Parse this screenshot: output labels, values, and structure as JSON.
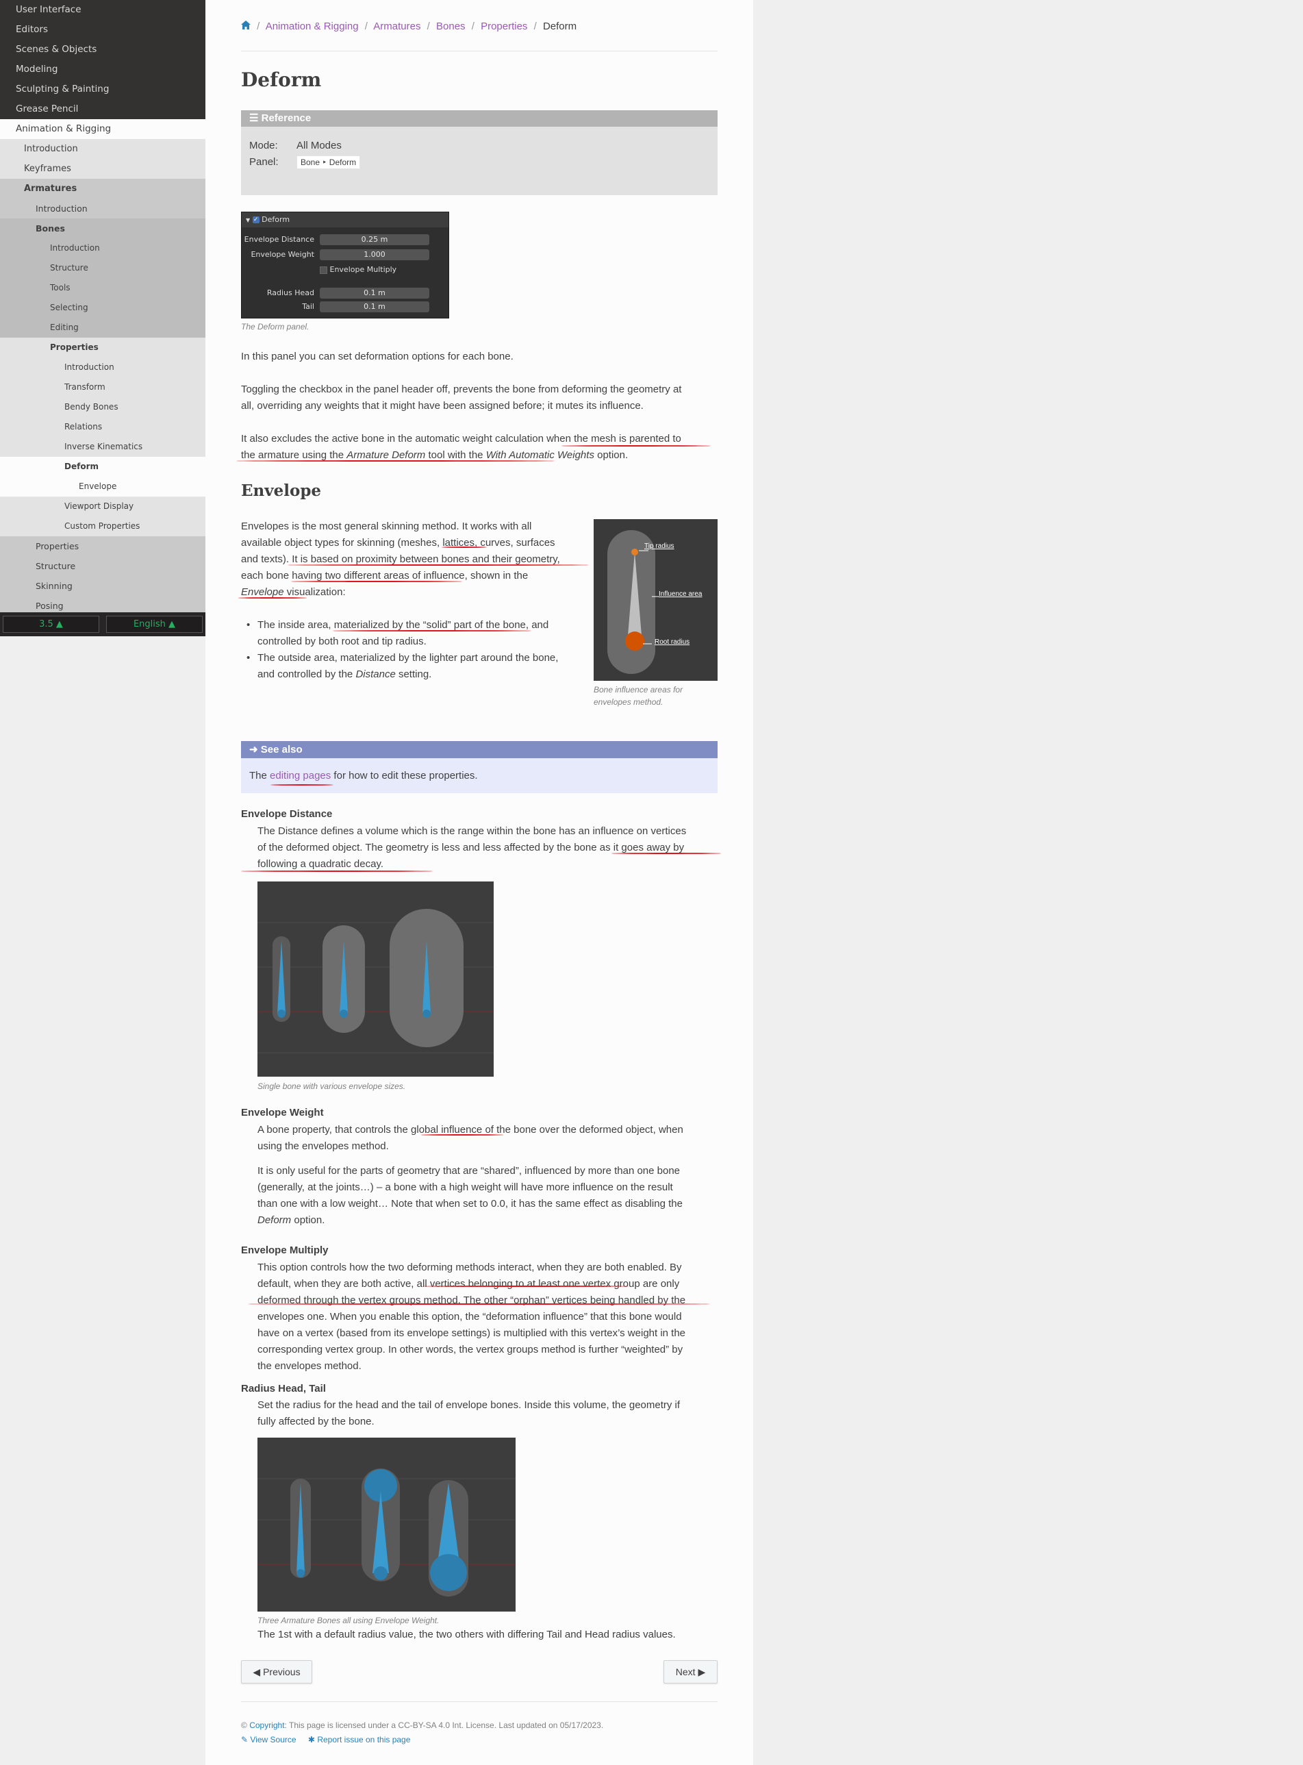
{
  "sidebar": {
    "items": [
      {
        "label": "User Interface",
        "level": 0
      },
      {
        "label": "Editors",
        "level": 0
      },
      {
        "label": "Scenes & Objects",
        "level": 0
      },
      {
        "label": "Modeling",
        "level": 0
      },
      {
        "label": "Sculpting & Painting",
        "level": 0
      },
      {
        "label": "Grease Pencil",
        "level": 0
      },
      {
        "label": "Animation & Rigging",
        "level": 0,
        "current": true
      },
      {
        "label": "Introduction",
        "level": 1
      },
      {
        "label": "Keyframes",
        "level": 1
      },
      {
        "label": "Armatures",
        "level": 1,
        "current": true
      },
      {
        "label": "Introduction",
        "level": 2
      },
      {
        "label": "Bones",
        "level": 2,
        "current": true
      },
      {
        "label": "Introduction",
        "level": 3
      },
      {
        "label": "Structure",
        "level": 3
      },
      {
        "label": "Tools",
        "level": 3
      },
      {
        "label": "Selecting",
        "level": 3
      },
      {
        "label": "Editing",
        "level": 3
      },
      {
        "label": "Properties",
        "level": 3,
        "current": true
      },
      {
        "label": "Introduction",
        "level": 4
      },
      {
        "label": "Transform",
        "level": 4
      },
      {
        "label": "Bendy Bones",
        "level": 4
      },
      {
        "label": "Relations",
        "level": 4
      },
      {
        "label": "Inverse Kinematics",
        "level": 4
      },
      {
        "label": "Deform",
        "level": 4,
        "current": true
      },
      {
        "label": "Envelope",
        "level": 5
      },
      {
        "label": "Viewport Display",
        "level": 4
      },
      {
        "label": "Custom Properties",
        "level": 4
      },
      {
        "label": "Properties",
        "level": 2
      },
      {
        "label": "Structure",
        "level": 2
      },
      {
        "label": "Skinning",
        "level": 2
      },
      {
        "label": "Posing",
        "level": 2
      }
    ],
    "version": "3.5",
    "language": "English"
  },
  "breadcrumb": [
    "Animation & Rigging",
    "Armatures",
    "Bones",
    "Properties",
    "Deform"
  ],
  "page_title": "Deform",
  "reference": {
    "header": "Reference",
    "mode_label": "Mode:",
    "mode_value": "All Modes",
    "panel_label": "Panel:",
    "panel_value": "Bone ‣ Deform"
  },
  "deform_panel": {
    "header": "Deform",
    "rows": [
      {
        "label": "Envelope Distance",
        "value": "0.25 m"
      },
      {
        "label": "Envelope Weight",
        "value": "1.000"
      },
      {
        "label": "Envelope Multiply",
        "checkbox": true
      },
      {
        "label": "Radius Head",
        "value": "0.1 m"
      },
      {
        "label": "Tail",
        "value": "0.1 m"
      }
    ],
    "caption": "The Deform panel."
  },
  "intro": {
    "p1": "In this panel you can set deformation options for each bone.",
    "p2a": "Toggling the checkbox in the panel header off, prevents the bone from deforming the geometry at",
    "p2b": "all, overriding any weights that it might have been assigned before; it mutes its influence.",
    "p3a": "It also excludes the active bone in the automatic weight calculation when the mesh is parented to",
    "p3b_1": "the armature using the ",
    "p3b_em1": "Armature Deform",
    "p3b_2": " tool with the ",
    "p3b_em2": "With Automatic Weights",
    "p3b_3": " option."
  },
  "envelope": {
    "heading": "Envelope",
    "lines": [
      "Envelopes is the most general skinning method. It works with all",
      "available object types for skinning (meshes, lattices, curves, surfaces",
      "and texts). It is based on proximity between bones and their geometry,",
      "each bone having two different areas of influence, shown in the"
    ],
    "line5_em": "Envelope",
    "line5_rest": " visualization:",
    "bullet1a": "The inside area, materialized by the “solid” part of the bone, and",
    "bullet1b": "controlled by both root and tip radius.",
    "bullet2a": "The outside area, materialized by the lighter part around the bone,",
    "bullet2b_1": "and controlled by the ",
    "bullet2b_em": "Distance",
    "bullet2b_2": " setting.",
    "figure": {
      "tip": "Tip radius",
      "influence": "Influence area",
      "root": "Root radius"
    },
    "caption_1": "Bone influence areas for",
    "caption_2": "envelopes method."
  },
  "see_also": {
    "header": "See also",
    "text_1": "The ",
    "link": "editing pages",
    "text_2": " for how to edit these properties."
  },
  "envelope_distance": {
    "term": "Envelope Distance",
    "lines": [
      "The Distance defines a volume which is the range within the bone has an influence on vertices",
      "of the deformed object. The geometry is less and less affected by the bone as it goes away by",
      "following a quadratic decay."
    ],
    "caption": "Single bone with various envelope sizes."
  },
  "envelope_weight": {
    "term": "Envelope Weight",
    "lines": [
      "A bone property, that controls the global influence of the bone over the deformed object, when",
      "using the envelopes method."
    ],
    "lines2": [
      "It is only useful for the parts of geometry that are “shared”, influenced by more than one bone",
      "(generally, at the joints…) – a bone with a high weight will have more influence on the result",
      "than one with a low weight… Note that when set to 0.0, it has the same effect as disabling the"
    ],
    "last_em": "Deform",
    "last_rest": " option."
  },
  "envelope_multiply": {
    "term": "Envelope Multiply",
    "lines": [
      "This option controls how the two deforming methods interact, when they are both enabled. By",
      "default, when they are both active, all vertices belonging to at least one vertex group are only",
      "deformed through the vertex groups method. The other “orphan” vertices being handled by the",
      "envelopes one. When you enable this option, the “deformation influence” that this bone would",
      "have on a vertex (based from its envelope settings) is multiplied with this vertex’s weight in the",
      "corresponding vertex group. In other words, the vertex groups method is further “weighted” by",
      "the envelopes method."
    ]
  },
  "radius": {
    "term": "Radius Head, Tail",
    "lines": [
      "Set the radius for the head and the tail of envelope bones. Inside this volume, the geometry if",
      "fully affected by the bone."
    ],
    "caption": "Three Armature Bones all using Envelope Weight.",
    "after": "The 1st with a default radius value, the two others with differing Tail and Head radius values."
  },
  "nav": {
    "previous": "Previous",
    "next": "Next"
  },
  "footer": {
    "copyright_symbol": "©",
    "copyright_link": "Copyright",
    "text": ": This page is licensed under a CC-BY-SA 4.0 Int. License. Last updated on 05/17/2023.",
    "view_source": "View Source",
    "report_issue": "Report issue on this page"
  },
  "colors": {
    "sidebar_bg": "#343131",
    "link": "#9b59b6",
    "note_header": "#7f8dc4",
    "note_bg": "#e7eafa",
    "reference_header": "#b3b3b3",
    "reference_bg": "#e1e1e1",
    "underline": "#e0141e"
  }
}
